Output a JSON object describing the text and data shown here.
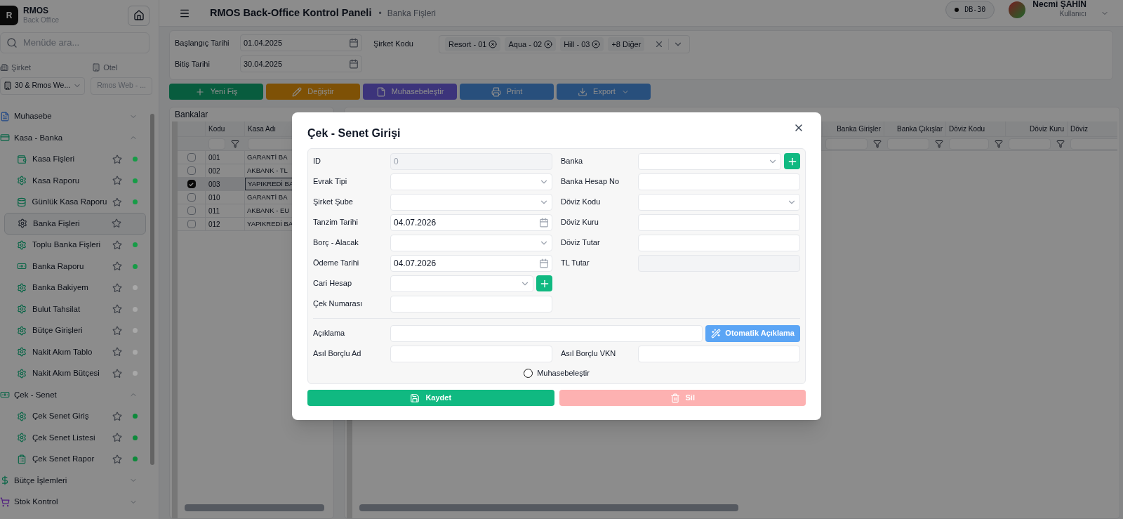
{
  "app": {
    "logo_letter": "R",
    "name": "RMOS",
    "subtitle": "Back Office"
  },
  "header": {
    "title": "RMOS Back-Office Kontrol Paneli",
    "separator": "•",
    "breadcrumb": "Banka Fişleri",
    "db_badge": "DB-30",
    "user_name": "Necmi ŞAHİN",
    "user_role": "Kullanıcı"
  },
  "sidebar": {
    "search_placeholder": "Menüde ara...",
    "company_label": "Şirket",
    "company_value": "30 & Rmos We...",
    "hotel_label": "Otel",
    "hotel_value": "Rmos Web - ...",
    "groups": [
      {
        "label": "Muhasebe",
        "kind": "document",
        "expanded": false
      },
      {
        "label": "Kasa - Banka",
        "kind": "card",
        "expanded": true,
        "children": [
          {
            "label": "Kasa Fişleri",
            "kind": "wallet",
            "selected": false,
            "color": "#169c46"
          },
          {
            "label": "Kasa Raporu",
            "kind": "gear",
            "selected": false,
            "color": "#169c46"
          },
          {
            "label": "Günlük Kasa Raporu",
            "kind": "database",
            "selected": false,
            "color": "#169c46"
          },
          {
            "label": "Banka Fişleri",
            "kind": "gear",
            "selected": true
          },
          {
            "label": "Toplu Banka Fişleri",
            "kind": "gear",
            "selected": false,
            "color": "#169c46"
          },
          {
            "label": "Banka Raporu",
            "kind": "banknote",
            "selected": false,
            "color": "#169c46"
          },
          {
            "label": "Banka Bakiyem",
            "kind": "gear",
            "selected": false,
            "color": "#a8a8a8"
          },
          {
            "label": "Bulut Tahsilat",
            "kind": "gear",
            "selected": false,
            "color": "#a8a8a8"
          },
          {
            "label": "Bütçe Girişleri",
            "kind": "gear",
            "selected": false,
            "color": "#a8a8a8"
          },
          {
            "label": "Nakit Akım Tablo",
            "kind": "gear",
            "selected": false,
            "color": "#a8a8a8"
          },
          {
            "label": "Nakit Akım Bütçesi",
            "kind": "gear",
            "selected": false,
            "color": "#a8a8a8"
          }
        ]
      },
      {
        "label": "Çek - Senet",
        "kind": "banknote",
        "expanded": true,
        "children": [
          {
            "label": "Çek Senet Giriş",
            "kind": "gear",
            "selected": false,
            "color": "#0c8a3a"
          },
          {
            "label": "Çek Senet Listesi",
            "kind": "gear",
            "selected": false,
            "color": "#0c8a3a"
          },
          {
            "label": "Çek Senet Rapor",
            "kind": "clipboard",
            "selected": false,
            "color": "#0c8a3a"
          }
        ]
      },
      {
        "label": "Bütçe İşlemleri",
        "kind": "dollar",
        "expanded": false
      },
      {
        "label": "Stok Kontrol",
        "kind": "cart",
        "expanded": false
      }
    ]
  },
  "filters": {
    "start_label": "Başlangıç Tarihi",
    "start_value": "01.04.2025",
    "end_label": "Bitiş Tarihi",
    "end_value": "30.04.2025",
    "company_code_label": "Şirket Kodu",
    "tags": [
      "Resort - 01",
      "Aqua - 02",
      "Hill - 03"
    ],
    "more": "+8 Diğer"
  },
  "toolbar": [
    {
      "label": "Yeni Fiş",
      "kind": "new"
    },
    {
      "label": "Değiştir",
      "kind": "edit"
    },
    {
      "label": "Muhasebeleştir",
      "kind": "post"
    },
    {
      "label": "Print",
      "kind": "print"
    },
    {
      "label": "Export",
      "kind": "export"
    }
  ],
  "bank_grid": {
    "title": "Bankalar",
    "columns": [
      "Kodu",
      "Kasa Adı"
    ],
    "rows": [
      {
        "checked": false,
        "code": "001",
        "name": "GARANTİ BA"
      },
      {
        "checked": false,
        "code": "002",
        "name": "AKBANK - TL"
      },
      {
        "checked": true,
        "code": "003",
        "name": "YAPIKREDİ BA"
      },
      {
        "checked": false,
        "code": "010",
        "name": "GARANTİ BA"
      },
      {
        "checked": false,
        "code": "011",
        "name": "AKBANK - EU"
      },
      {
        "checked": false,
        "code": "012",
        "name": "YAPIKREDİ BA"
      }
    ]
  },
  "movements_grid": {
    "columns": [
      "Banka Girişler",
      "Banka Çıkışlar",
      "Döviz Kodu",
      "Döviz Kuru",
      "Döviz"
    ]
  },
  "dialog": {
    "title": "Çek - Senet Girişi",
    "left_fields": [
      {
        "label": "ID",
        "kind": "readonly",
        "placeholder": "0"
      },
      {
        "label": "Evrak Tipi",
        "kind": "select"
      },
      {
        "label": "Şirket Şube",
        "kind": "select"
      },
      {
        "label": "Tanzim Tarihi",
        "kind": "date",
        "value": "04.07.2026"
      },
      {
        "label": "Borç - Alacak",
        "kind": "select"
      },
      {
        "label": "Ödeme Tarihi",
        "kind": "date",
        "value": "04.07.2026"
      },
      {
        "label": "Cari Hesap",
        "kind": "select_add"
      },
      {
        "label": "Çek Numarası",
        "kind": "text"
      }
    ],
    "right_fields": [
      {
        "label": "Banka",
        "kind": "select_add"
      },
      {
        "label": "Banka Hesap No",
        "kind": "text"
      },
      {
        "label": "Döviz Kodu",
        "kind": "select"
      },
      {
        "label": "Döviz Kuru",
        "kind": "text"
      },
      {
        "label": "Döviz Tutar",
        "kind": "text"
      },
      {
        "label": "TL Tutar",
        "kind": "readonly"
      }
    ],
    "description_label": "Açıklama",
    "auto_button": "Otomatik Açıklama",
    "debtor_name_label": "Asıl Borçlu Ad",
    "debtor_vkn_label": "Asıl Borçlu VKN",
    "post_option": {
      "label": "Muhasebeleştir",
      "checked": false
    },
    "save_button": {
      "label": "Kaydet",
      "disabled": false
    },
    "delete_button": {
      "label": "Sil",
      "disabled": true
    }
  }
}
